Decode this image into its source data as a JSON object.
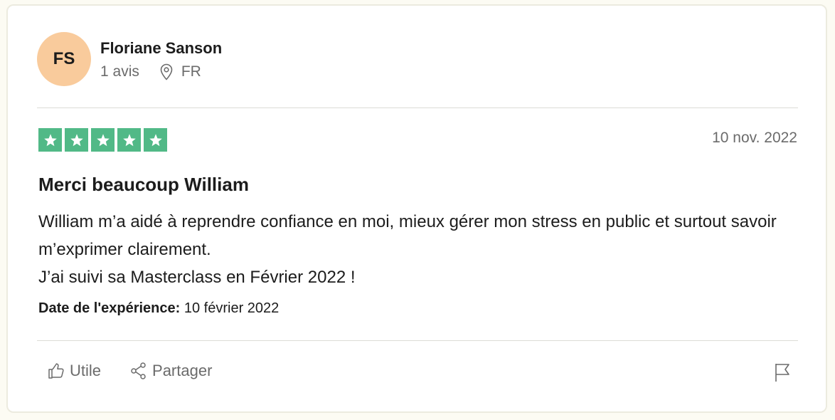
{
  "reviewer": {
    "initials": "FS",
    "name": "Floriane Sanson",
    "review_count": "1 avis",
    "country": "FR",
    "avatar_color": "#f9cb9c"
  },
  "review": {
    "rating": 5,
    "max_rating": 5,
    "star_color": "#51b987",
    "date": "10 nov. 2022",
    "title": "Merci beaucoup William",
    "body_lines": [
      "William m’a aidé à reprendre confiance en moi, mieux gérer mon stress en public et surtout savoir m’exprimer clairement.",
      "J’ai suivi sa Masterclass en Février 2022 !"
    ],
    "experience_label": "Date de l'expérience:",
    "experience_date": "10 février 2022"
  },
  "actions": {
    "useful_label": "Utile",
    "share_label": "Partager",
    "useful_icon": "thumbs-up-icon",
    "share_icon": "share-icon",
    "report_icon": "flag-icon"
  }
}
